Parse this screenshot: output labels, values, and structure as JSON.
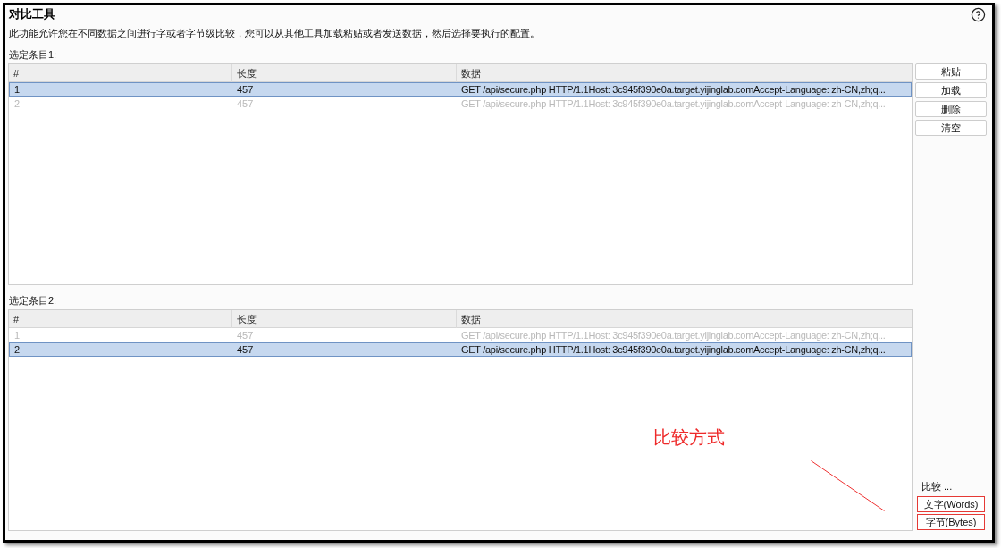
{
  "title": "对比工具",
  "description": "此功能允许您在不同数据之间进行字或者字节级比较，您可以从其他工具加载粘贴或者发送数据，然后选择要执行的配置。",
  "item_lists": [
    {
      "label": "选定条目1:",
      "columns": [
        "#",
        "长度",
        "数据"
      ],
      "rows": [
        {
          "cells": [
            "1",
            "457",
            "GET /api/secure.php HTTP/1.1Host: 3c945f390e0a.target.yijinglab.comAccept-Language: zh-CN,zh;q..."
          ],
          "selected": true,
          "dimmed": false
        },
        {
          "cells": [
            "2",
            "457",
            "GET /api/secure.php HTTP/1.1Host: 3c945f390e0a.target.yijinglab.comAccept-Language: zh-CN,zh;q..."
          ],
          "selected": false,
          "dimmed": true
        }
      ]
    },
    {
      "label": "选定条目2:",
      "columns": [
        "#",
        "长度",
        "数据"
      ],
      "rows": [
        {
          "cells": [
            "1",
            "457",
            "GET /api/secure.php HTTP/1.1Host: 3c945f390e0a.target.yijinglab.comAccept-Language: zh-CN,zh;q..."
          ],
          "selected": false,
          "dimmed": true
        },
        {
          "cells": [
            "2",
            "457",
            "GET /api/secure.php HTTP/1.1Host: 3c945f390e0a.target.yijinglab.comAccept-Language: zh-CN,zh;q..."
          ],
          "selected": true,
          "dimmed": false
        }
      ]
    }
  ],
  "list_buttons": [
    "粘贴",
    "加载",
    "删除",
    "清空"
  ],
  "compare": {
    "label": "比较 ...",
    "buttons": [
      {
        "label": "文字(Words)",
        "highlighted": true
      },
      {
        "label": "字节(Bytes)",
        "highlighted": true
      }
    ]
  },
  "annotation": {
    "text": "比较方式"
  }
}
